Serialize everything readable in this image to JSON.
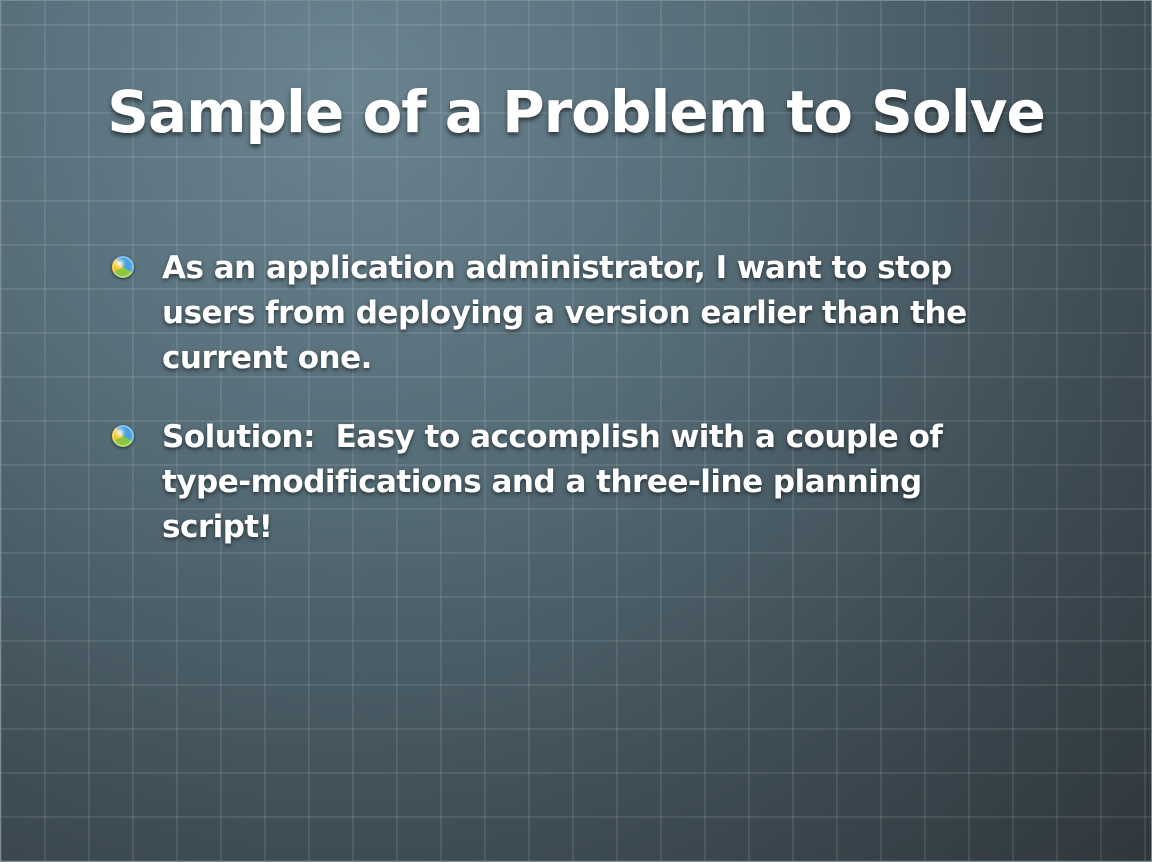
{
  "slide": {
    "title": "Sample of a Problem to Solve",
    "bullets": [
      {
        "icon": "globe-bullet-icon",
        "text": "As an application administrator, I want to stop users from deploying a version earlier than the current one."
      },
      {
        "icon": "globe-bullet-icon",
        "text": "Solution:  Easy to accomplish with a couple of type-modifications and a three-line planning script!"
      }
    ]
  }
}
